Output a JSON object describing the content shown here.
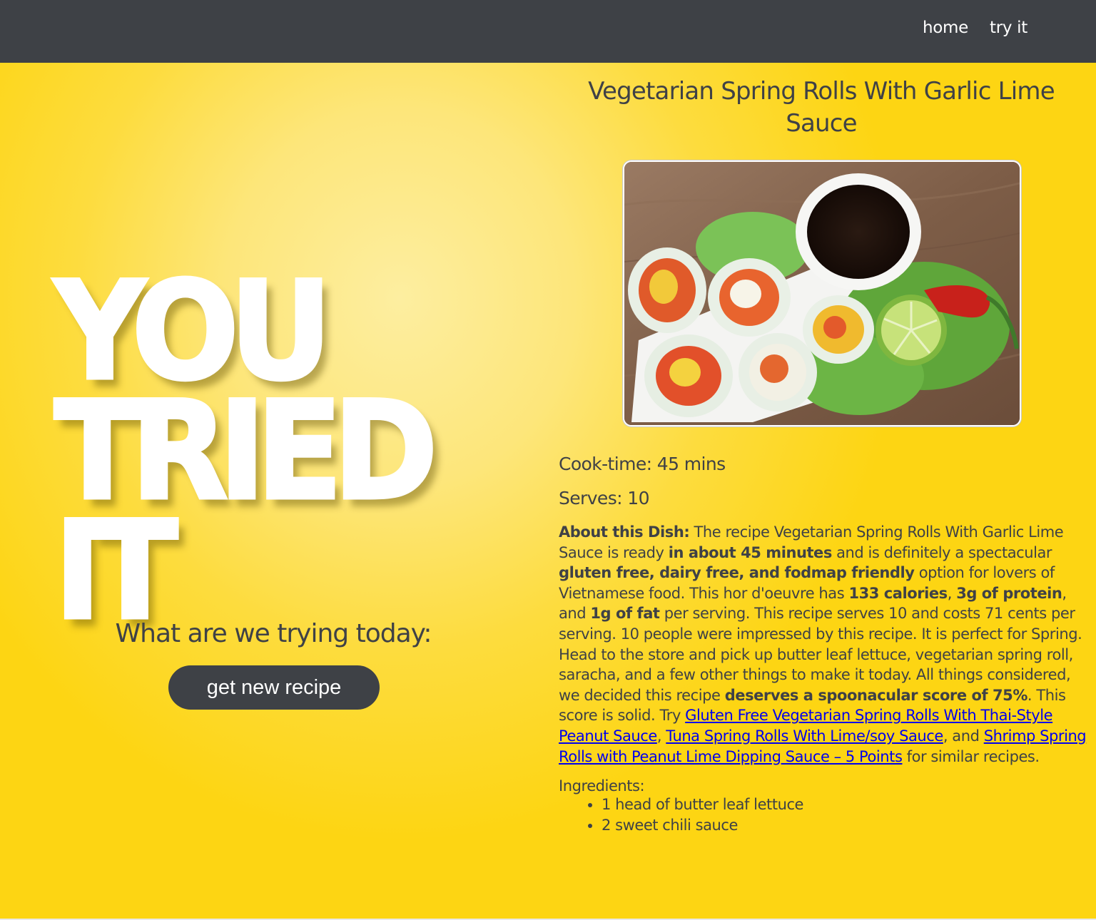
{
  "nav": {
    "links": [
      {
        "label": "home"
      },
      {
        "label": "try it"
      }
    ]
  },
  "hero": {
    "line1": "YOU",
    "line2": "TRIED",
    "line3": "IT",
    "prompt": "What are we trying today:",
    "button_label": "get new recipe"
  },
  "recipe": {
    "title": "Vegetarian Spring Rolls With Garlic Lime Sauce",
    "image_alt": "Vegetarian spring rolls with dipping sauce",
    "cook_time": "Cook-time: 45 mins",
    "serves": "Serves: 10",
    "about": {
      "label": "About this Dish:",
      "t1": " The recipe Vegetarian Spring Rolls With Garlic Lime Sauce is ready ",
      "b1": "in about 45 minutes",
      "t2": " and is definitely a spectacular ",
      "b2": "gluten free, dairy free, and fodmap friendly",
      "t3": " option for lovers of Vietnamese food. This hor d'oeuvre has ",
      "b3": "133 calories",
      "t4": ", ",
      "b4": "3g of protein",
      "t5": ", and ",
      "b5": "1g of fat",
      "t6": " per serving. This recipe serves 10 and costs 71 cents per serving. 10 people were impressed by this recipe. It is perfect for Spring. Head to the store and pick up butter leaf lettuce, vegetarian spring roll, saracha, and a few other things to make it today. All things considered, we decided this recipe ",
      "b6": "deserves a spoonacular score of 75%",
      "t7": ". This score is solid. Try ",
      "link1": "Gluten Free Vegetarian Spring Rolls With Thai-Style Peanut Sauce",
      "t8": ", ",
      "link2": "Tuna Spring Rolls With Lime/soy Sauce",
      "t9": ", and ",
      "link3": "Shrimp Spring Rolls with Peanut Lime Dipping Sauce – 5 Points",
      "t10": " for similar recipes."
    },
    "ingredients_label": "Ingredients:",
    "ingredients": [
      "1 head of butter leaf lettuce",
      "2 sweet chili sauce"
    ]
  }
}
